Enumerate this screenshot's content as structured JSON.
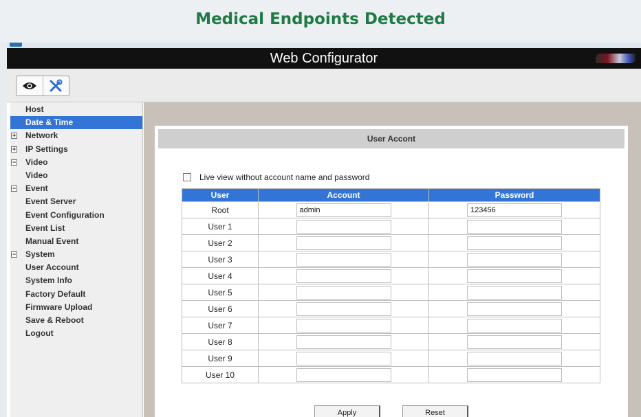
{
  "banner": {
    "title": "Medical Endpoints Detected"
  },
  "app": {
    "title": "Web Configurator"
  },
  "toolbar": {
    "icons": [
      "eye-icon",
      "tools-icon"
    ]
  },
  "sidebar": {
    "items": [
      {
        "label": "Host"
      },
      {
        "label": "Date & Time",
        "active": true
      },
      {
        "label": "Network",
        "toggle": "+"
      },
      {
        "label": "IP Settings",
        "toggle": "+"
      },
      {
        "label": "Video",
        "toggle": "−"
      },
      {
        "label": "Video"
      },
      {
        "label": "Event",
        "toggle": "−"
      },
      {
        "label": "Event Server"
      },
      {
        "label": "Event Configuration"
      },
      {
        "label": "Event List"
      },
      {
        "label": "Manual Event"
      },
      {
        "label": "System",
        "toggle": "−"
      },
      {
        "label": "User Account"
      },
      {
        "label": "System Info"
      },
      {
        "label": "Factory Default"
      },
      {
        "label": "Firmware Upload"
      },
      {
        "label": "Save & Reboot"
      },
      {
        "label": "Logout"
      }
    ]
  },
  "panel": {
    "header": "User Accont",
    "live_view_label": "Live view without account name and password",
    "live_view_checked": false,
    "columns": {
      "user": "User",
      "account": "Account",
      "password": "Password"
    },
    "rows": [
      {
        "user": "Root",
        "account": "admin",
        "password": "123456"
      },
      {
        "user": "User  1",
        "account": "",
        "password": ""
      },
      {
        "user": "User  2",
        "account": "",
        "password": ""
      },
      {
        "user": "User  3",
        "account": "",
        "password": ""
      },
      {
        "user": "User  4",
        "account": "",
        "password": ""
      },
      {
        "user": "User  5",
        "account": "",
        "password": ""
      },
      {
        "user": "User  6",
        "account": "",
        "password": ""
      },
      {
        "user": "User  7",
        "account": "",
        "password": ""
      },
      {
        "user": "User  8",
        "account": "",
        "password": ""
      },
      {
        "user": "User  9",
        "account": "",
        "password": ""
      },
      {
        "user": "User  10",
        "account": "",
        "password": ""
      }
    ],
    "apply_label": "Apply",
    "reset_label": "Reset"
  },
  "colors": {
    "accent": "#3375d6",
    "banner_text": "#1f7a45",
    "titlebar": "#111111",
    "content_bg": "#c7c1ba"
  }
}
